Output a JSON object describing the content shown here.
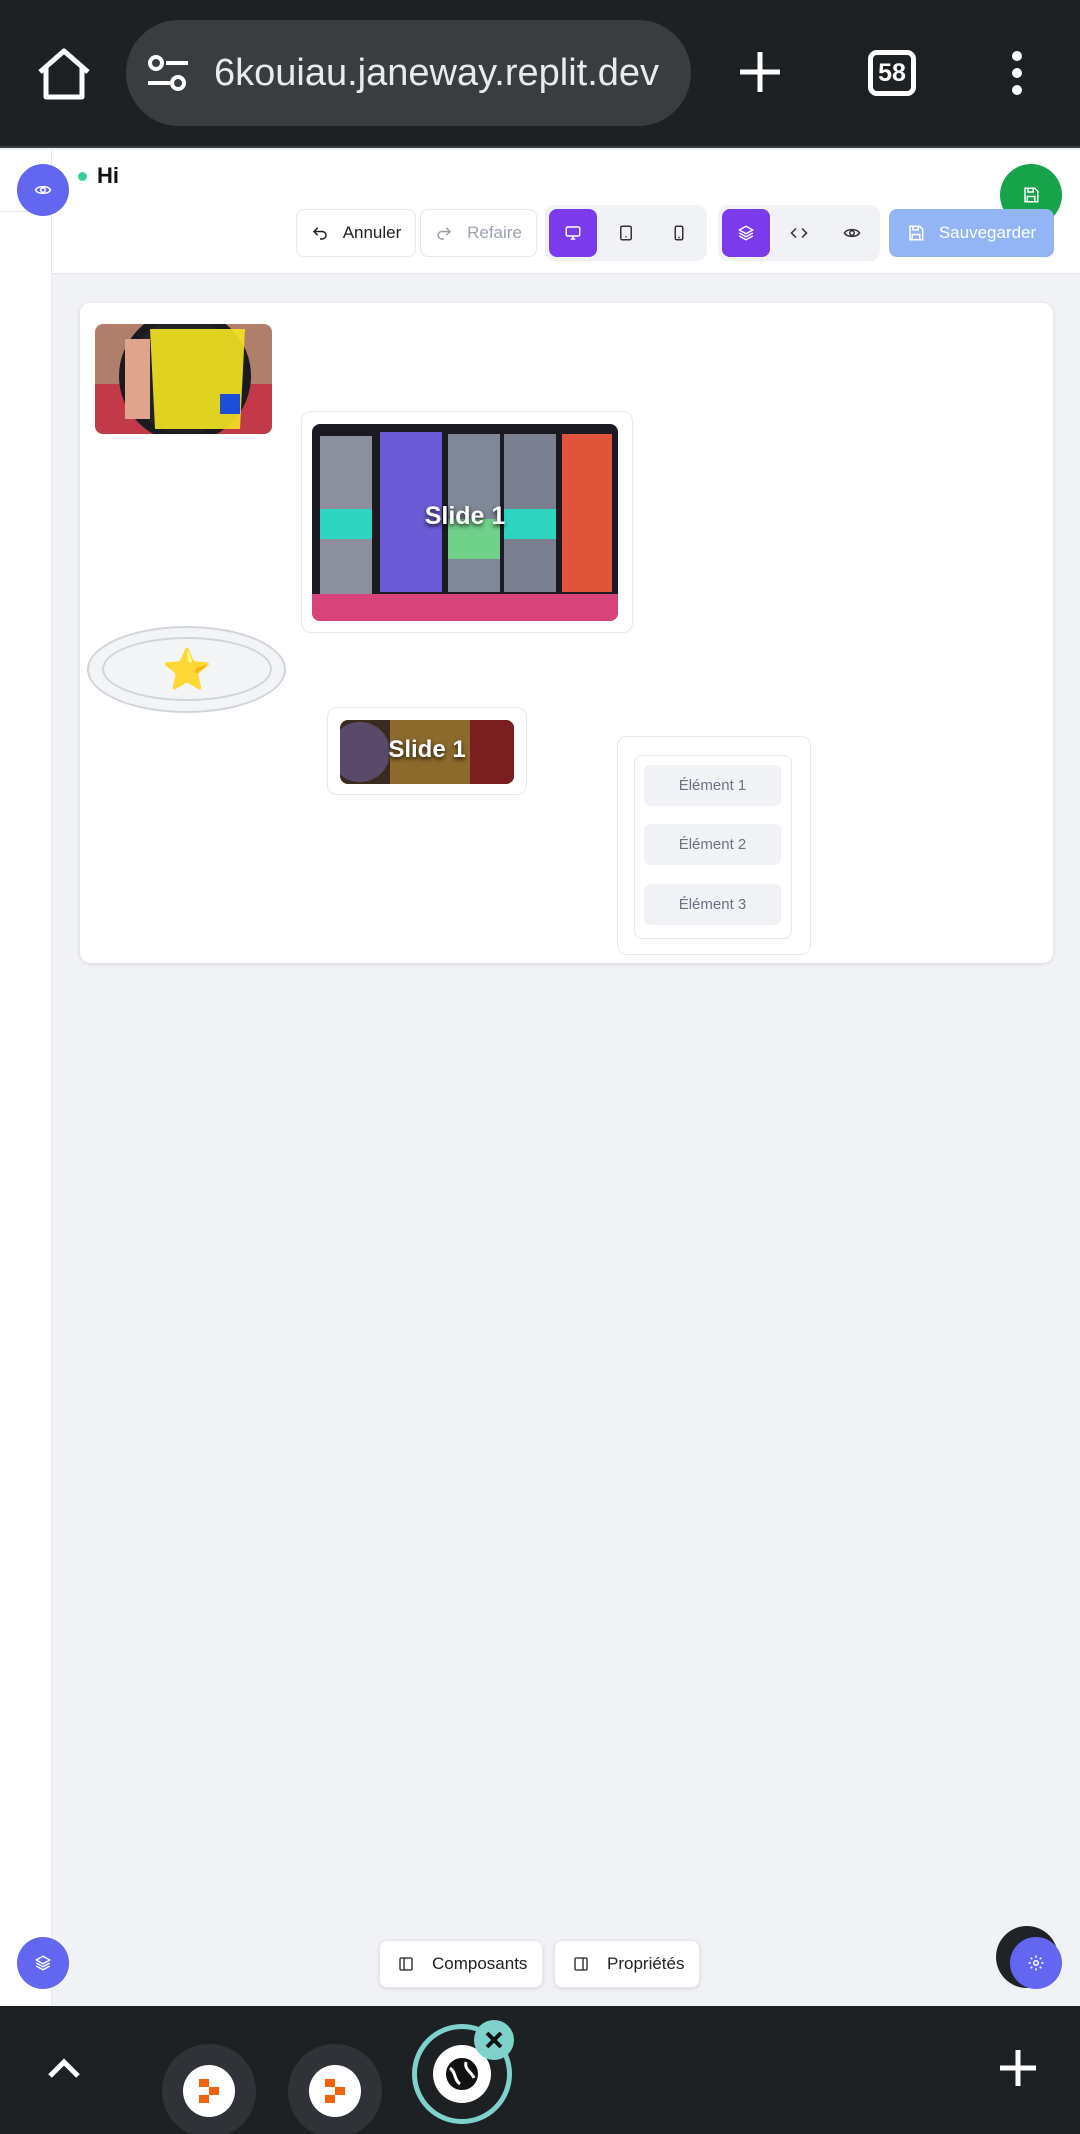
{
  "browser": {
    "url": "6kouiau.janeway.replit.dev",
    "tab_count": "58"
  },
  "app": {
    "project_name": "Hi",
    "toolbar": {
      "undo_label": "Annuler",
      "redo_label": "Refaire",
      "save_label": "Sauvegarder"
    },
    "canvas": {
      "slide1_title": "Slide 1",
      "slide2_title": "Slide 1",
      "star_glyph": "⭐",
      "list_items": [
        "Élément 1",
        "Élément 2",
        "Élément 3"
      ]
    },
    "bottom": {
      "components_label": "Composants",
      "properties_label": "Propriétés"
    }
  },
  "colors": {
    "accent": "#6366f1",
    "active": "#7c3aed",
    "save_fab": "#16a34a",
    "save_button": "#93b4f5"
  }
}
